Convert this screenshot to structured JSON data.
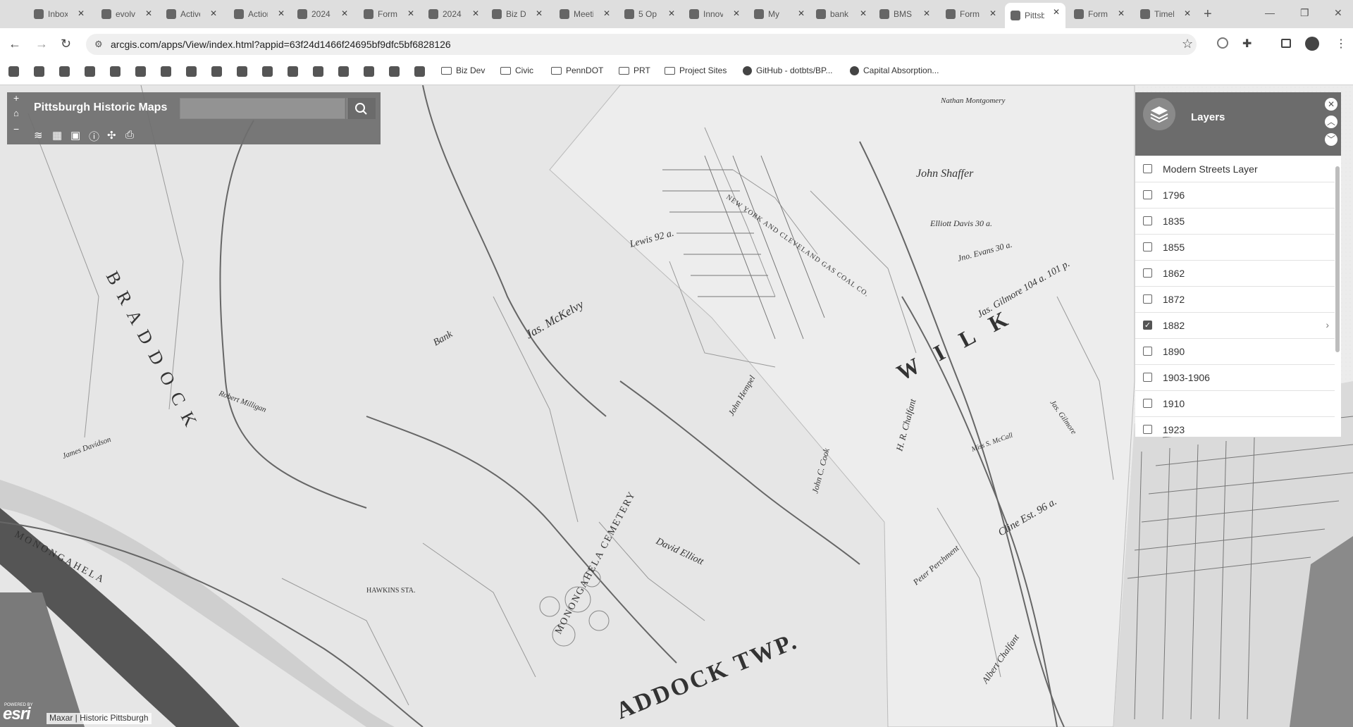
{
  "browser": {
    "tabs": [
      {
        "title": "Inbox",
        "icon": "gmail-icon"
      },
      {
        "title": "evolve",
        "icon": "calendar-icon"
      },
      {
        "title": "Active",
        "icon": "drive-icon"
      },
      {
        "title": "Action",
        "icon": "pdf-icon"
      },
      {
        "title": "2024",
        "icon": "doc-icon"
      },
      {
        "title": "Forms",
        "icon": "form-icon"
      },
      {
        "title": "2024",
        "icon": "globe-icon"
      },
      {
        "title": "Biz Dev",
        "icon": "m-icon"
      },
      {
        "title": "Meeting",
        "icon": "m-icon"
      },
      {
        "title": "5 Op",
        "icon": "m-icon"
      },
      {
        "title": "Innovation",
        "icon": "logo-icon"
      },
      {
        "title": "My",
        "icon": "drive-icon"
      },
      {
        "title": "bank",
        "icon": "table-icon"
      },
      {
        "title": "BMS",
        "icon": "m-icon"
      },
      {
        "title": "Forms",
        "icon": "flag-icon"
      },
      {
        "title": "Pittsburgh Historic Maps",
        "icon": "globe-icon",
        "active": true
      },
      {
        "title": "Forms",
        "icon": "pin-icon"
      },
      {
        "title": "Timeline",
        "icon": "m-icon"
      }
    ],
    "url": "arcgis.com/apps/View/index.html?appid=63f24d1466f24695bf9dfc5bf6828126",
    "bookmarks": [
      {
        "label": "Biz Dev",
        "type": "folder"
      },
      {
        "label": "Civic",
        "type": "folder"
      },
      {
        "label": "PennDOT",
        "type": "folder"
      },
      {
        "label": "PRT",
        "type": "folder"
      },
      {
        "label": "Project Sites",
        "type": "folder"
      },
      {
        "label": "GitHub - dotbts/BP...",
        "type": "github"
      },
      {
        "label": "Capital Absorption...",
        "type": "link"
      }
    ]
  },
  "app": {
    "title": "Pittsburgh Historic Maps",
    "search_placeholder": "",
    "tools": [
      "layers-icon",
      "legend-icon",
      "basemap-icon",
      "info-icon",
      "measure-icon",
      "print-icon"
    ],
    "zoom": {
      "in": "+",
      "home": "⌂",
      "out": "−"
    }
  },
  "layers_panel": {
    "title": "Layers",
    "layers": [
      {
        "name": "Modern Streets Layer",
        "checked": false
      },
      {
        "name": "1796",
        "checked": false
      },
      {
        "name": "1835",
        "checked": false
      },
      {
        "name": "1855",
        "checked": false
      },
      {
        "name": "1862",
        "checked": false
      },
      {
        "name": "1872",
        "checked": false
      },
      {
        "name": "1882",
        "checked": true,
        "expandable": true
      },
      {
        "name": "1890",
        "checked": false
      },
      {
        "name": "1903-1906",
        "checked": false
      },
      {
        "name": "1910",
        "checked": false
      },
      {
        "name": "1923",
        "checked": false
      }
    ]
  },
  "attribution": "Maxar | Historic Pittsburgh",
  "esri_logo": "esri",
  "esri_powered": "POWERED BY",
  "map_labels": {
    "township_braddock": "B R A D D O C K",
    "township_braddock_twp": "ADDOCK TWP.",
    "township_wilkins": "W I L K",
    "monongahela_river": "MONONGAHELA",
    "cemetery": "MONONGAHELA CEMETERY",
    "owner1": "Jas. McKelvy",
    "owner2": "John Shaffer",
    "owner3": "Jas. Gilmore 104 a. 101 p.",
    "owner4": "Elliott Davis 30 a.",
    "owner5": "Peter Perchment",
    "owner6": "Cline Est. 96 a.",
    "owner7": "David Elliott",
    "owner8": "Albert Chalfant",
    "owner9": "H. R. Chalfant",
    "owner10": "Lewis 92 a.",
    "owner11": "Nathan Montgomery",
    "owner12": "Bank",
    "owner13": "Robert Milligan",
    "owner14": "James Davidson",
    "owner15": "John Hempel",
    "owner16": "John C. Cook",
    "owner17": "Miss S. McCall",
    "owner18": "Jas. Gilmore",
    "owner19": "Jno. Evans 30 a.",
    "newyork": "NEW YORK AND CLEVELAND GAS COAL CO.",
    "hawkins": "HAWKINS STA."
  }
}
